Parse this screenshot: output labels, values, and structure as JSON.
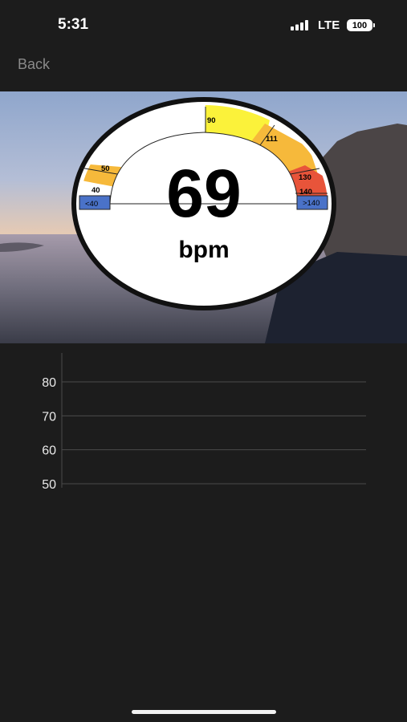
{
  "status_bar": {
    "time": "5:31",
    "network": "LTE",
    "battery": "100"
  },
  "nav": {
    "back_label": "Back"
  },
  "gauge": {
    "value": "69",
    "unit": "bpm",
    "zone_labels": {
      "below_40": "<40",
      "z40": "40",
      "z50": "50",
      "z90": "90",
      "z111": "111",
      "z130": "130",
      "z140": "140",
      "above_140": ">140"
    },
    "colors": {
      "blue": "#4a72c8",
      "orange": "#f6b93b",
      "yellow": "#fbf23a",
      "red": "#e8543a",
      "white": "#ffffff"
    }
  },
  "chart_data": {
    "type": "line",
    "y_ticks": [
      "80",
      "70",
      "60",
      "50"
    ],
    "ylim": [
      50,
      80
    ],
    "series": []
  },
  "colors": {
    "background": "#1c1c1c",
    "gridline": "#4a4a4a",
    "back_text": "#8a8a8a"
  }
}
